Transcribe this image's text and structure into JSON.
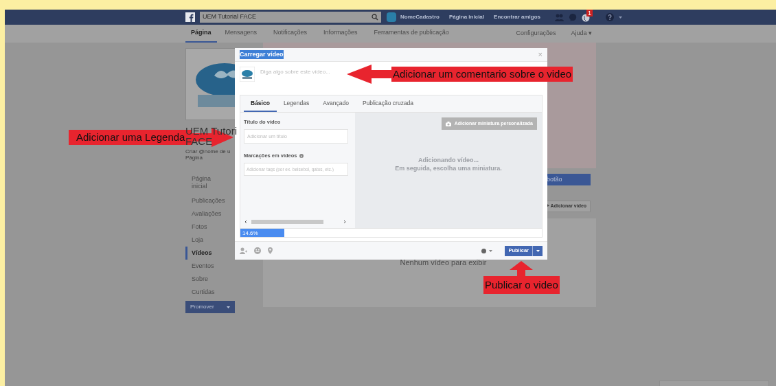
{
  "top_bar": {
    "search_value": "UEM Tutorial FACE",
    "user_name": "NomeCadastro",
    "links": [
      "Página inicial",
      "Encontrar amigos"
    ],
    "notification_count": "1"
  },
  "page_tabs": [
    {
      "label": "Página",
      "selected": true
    },
    {
      "label": "Mensagens",
      "selected": false
    },
    {
      "label": "Notificações",
      "selected": false
    },
    {
      "label": "Informações",
      "selected": false
    },
    {
      "label": "Ferramentas de publicação",
      "selected": false
    }
  ],
  "page_tabs_right": [
    "Configurações",
    "Ajuda ▾"
  ],
  "sidebar": {
    "page_name_lines": [
      "UEM Tutori",
      "FACE"
    ],
    "username_hint": "Criar @nome de u",
    "username_hint_2": "Página",
    "items": [
      {
        "label": "Página inicial",
        "selected": false
      },
      {
        "label": "Publicações",
        "selected": false
      },
      {
        "label": "Avaliações",
        "selected": false
      },
      {
        "label": "Fotos",
        "selected": false
      },
      {
        "label": "Loja",
        "selected": false
      },
      {
        "label": "Vídeos",
        "selected": true
      },
      {
        "label": "Eventos",
        "selected": false
      },
      {
        "label": "Sobre",
        "selected": false
      },
      {
        "label": "Curtidas",
        "selected": false
      }
    ],
    "promote_button": "Promover"
  },
  "main": {
    "cta_button": "botão",
    "add_video_button": "+ Adicionar vídeo",
    "empty_message": "Nenhum vídeo para exibir"
  },
  "dialog": {
    "title": "Carregar vídeo",
    "close": "×",
    "composer_placeholder": "Diga algo sobre este vídeo...",
    "tabs": [
      {
        "label": "Básico",
        "selected": true
      },
      {
        "label": "Legendas",
        "selected": false
      },
      {
        "label": "Avançado",
        "selected": false
      },
      {
        "label": "Publicação cruzada",
        "selected": false
      }
    ],
    "title_label": "Título do vídeo",
    "title_placeholder": "Adicionar um título",
    "tags_label": "Marcações em vídeos",
    "tags_placeholder": "Adicionar tags (por ex. beisebol, gatos, etc.)",
    "thumbnail_button": "Adicionar miniatura personalizada",
    "status_lines": [
      "Adicionando vídeo...",
      "Em seguida, escolha uma miniatura."
    ],
    "progress": {
      "level": 0.146,
      "reading": "14.6%"
    },
    "publish_button": "Publicar"
  },
  "annotations": [
    {
      "kind": "left",
      "text": "Adicionar um comentario sobre o video"
    },
    {
      "kind": "right",
      "text": "Adicionar uma Legenda"
    },
    {
      "kind": "up",
      "text": "Publicar o video"
    }
  ]
}
